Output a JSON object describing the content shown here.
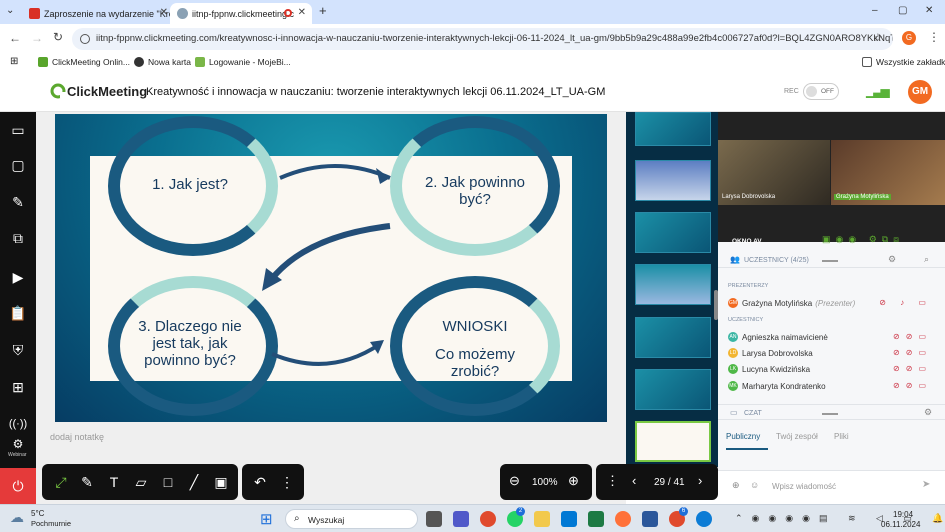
{
  "browser": {
    "tabs": [
      {
        "title": "Zaproszenie na wydarzenie \"Kre",
        "active": false
      },
      {
        "title": "iitnp-fppnw.clickmeeting.c",
        "active": true
      }
    ],
    "new_tab": "+",
    "url": "iitnp-fppnw.clickmeeting.com/kreatywnosc-i-innowacja-w-nauczaniu-tworzenie-interaktywnych-lekcji-06-11-2024_lt_ua-gm/9bb5b9a29c488a99e2fb4c006727af0d?l=BQL4ZGN0ARO8YKkNqTlho/kucvb6...",
    "profile_initial": "G",
    "bookmarks": [
      "ClickMeeting Onlin...",
      "Nowa karta",
      "Logowanie - MojeBi..."
    ],
    "all_bookmarks": "Wszystkie zakładki",
    "window_controls": [
      "–",
      "▢",
      "✕"
    ]
  },
  "app": {
    "logo": "ClickMeeting",
    "title": "Kreatywność i innowacja w nauczaniu: tworzenie interaktywnych lekcji 06.11.2024_LT_UA-GM",
    "rec_label": "REC",
    "rec_toggle": "OFF",
    "avatar_initials": "GM",
    "accent": "#f26a21"
  },
  "sidebar": {
    "items": [
      "menu-icon",
      "camera-icon",
      "folder-icon",
      "edit-icon",
      "screen-share-icon",
      "video-icon",
      "clipboard-icon",
      "shield-icon",
      "apps-icon",
      "broadcast-icon",
      "webinar-icon"
    ],
    "webinar_label": "Webinar",
    "exit": "power-icon"
  },
  "slide": {
    "q1": "1. Jak jest?",
    "q2": "2. Jak powinno być?",
    "q3": "3. Dlaczego nie jest tak, jak powinno być?",
    "q4_title": "WNIOSKI",
    "q4": "Co możemy zrobić?"
  },
  "notes_placeholder": "dodaj notatkę",
  "toolbar": {
    "zoom": "100%",
    "page": "29 / 41"
  },
  "panel": {
    "video_names": [
      "Larysa Dobrovolska",
      "Grażyna Motylińska"
    ],
    "av_window": "OKNO AV",
    "participants_header": "UCZESTNICY (4/25)",
    "presenters_label": "PREZENTERZY",
    "presenter": {
      "initials": "GM",
      "name": "Grażyna Motylińska",
      "role": "(Prezenter)"
    },
    "participants_label": "UCZESTNICY",
    "participants": [
      {
        "initials": "AN",
        "name": "Agnieszka naimavicienė",
        "color": "#3bb6a4"
      },
      {
        "initials": "LD",
        "name": "Larysa Dobrovolska",
        "color": "#f2b531"
      },
      {
        "initials": "LK",
        "name": "Lucyna Kwidzińska",
        "color": "#4fb848"
      },
      {
        "initials": "MK",
        "name": "Marharyta Kondratenko",
        "color": "#4fb848"
      }
    ],
    "chat_header": "CZAT",
    "chat_tabs": [
      "Publiczny",
      "Twój zespół",
      "Pliki"
    ],
    "chat_placeholder": "Wpisz wiadomość"
  },
  "taskbar": {
    "weather_temp": "5°C",
    "weather_desc": "Pochmurnie",
    "search": "Wyszukaj",
    "time": "19:04",
    "date": "06.11.2024",
    "teams_badge": "2",
    "chrome_badge": "6"
  }
}
